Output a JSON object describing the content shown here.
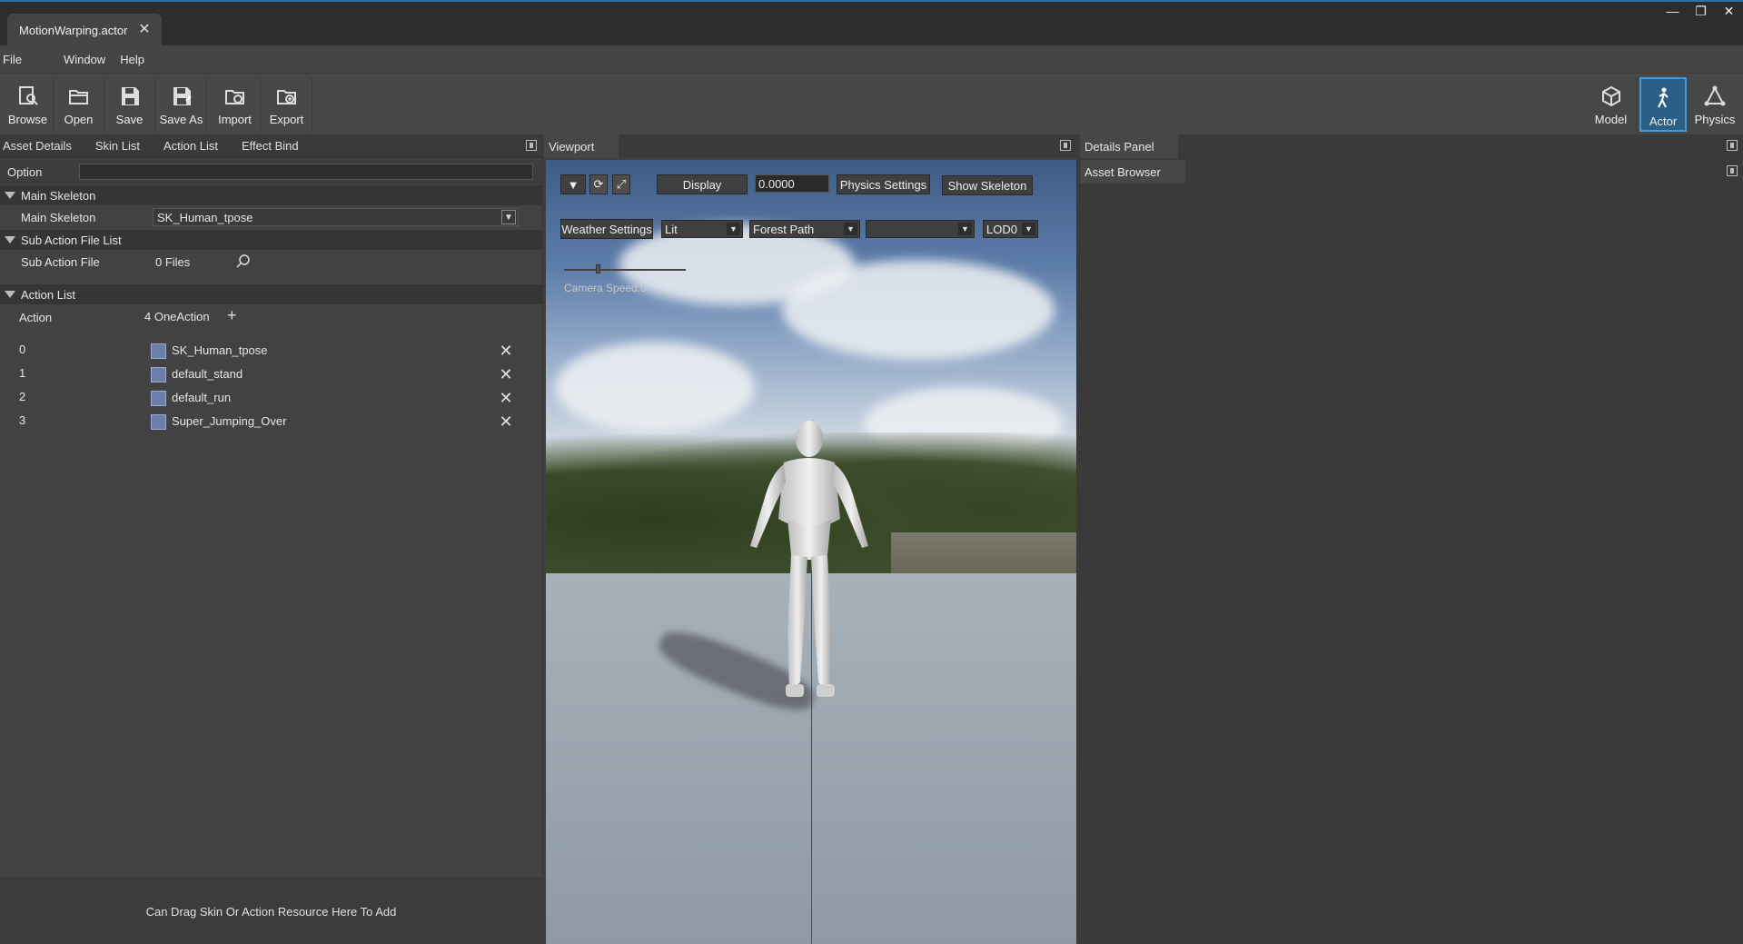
{
  "window": {
    "doc_tab": "MotionWarping.actor",
    "controls": [
      "minimize",
      "restore",
      "close"
    ]
  },
  "menu": [
    "File",
    "Window",
    "Help"
  ],
  "toolbar": {
    "left": [
      {
        "label": "Browse",
        "icon": "browse-icon"
      },
      {
        "label": "Open",
        "icon": "folder-open-icon"
      },
      {
        "label": "Save",
        "icon": "save-icon"
      },
      {
        "label": "Save As",
        "icon": "save-as-icon"
      },
      {
        "label": "Import",
        "icon": "import-icon"
      },
      {
        "label": "Export",
        "icon": "export-icon"
      }
    ],
    "right": [
      {
        "label": "Model",
        "icon": "cube-icon",
        "active": false
      },
      {
        "label": "Actor",
        "icon": "person-walking-icon",
        "active": true
      },
      {
        "label": "Physics",
        "icon": "nodes-icon",
        "active": false
      }
    ],
    "active_color": "#2b5f86"
  },
  "left_panel": {
    "tabs": [
      "Asset Details",
      "Skin List",
      "Action List",
      "Effect Bind"
    ],
    "option_label": "Option",
    "main_skeleton_section": "Main Skeleton",
    "main_skeleton_label": "Main Skeleton",
    "main_skeleton_value": "SK_Human_tpose",
    "sub_action_section": "Sub Action File List",
    "sub_action_label": "Sub Action File",
    "sub_action_value": "0 Files",
    "action_list_section": "Action List",
    "action_label": "Action",
    "action_value": "4 OneAction",
    "actions": [
      {
        "index": "0",
        "name": "SK_Human_tpose"
      },
      {
        "index": "1",
        "name": "default_stand"
      },
      {
        "index": "2",
        "name": "default_run"
      },
      {
        "index": "3",
        "name": "Super_Jumping_Over"
      }
    ],
    "footer_hint": "Can Drag Skin Or Action Resource Here To Add"
  },
  "viewport": {
    "tab": "Viewport",
    "display_button": "Display",
    "time_value": "0.0000",
    "physics_settings": "Physics Settings",
    "show_skeleton": "Show Skeleton",
    "weather_settings": "Weather Settings",
    "lighting_mode": "Lit",
    "environment": "Forest Path",
    "empty_select": "",
    "lod": "LOD0",
    "camera_speed": "Camera Speed:5"
  },
  "right_panel": {
    "details_tab": "Details Panel",
    "asset_browser_tab": "Asset Browser"
  }
}
